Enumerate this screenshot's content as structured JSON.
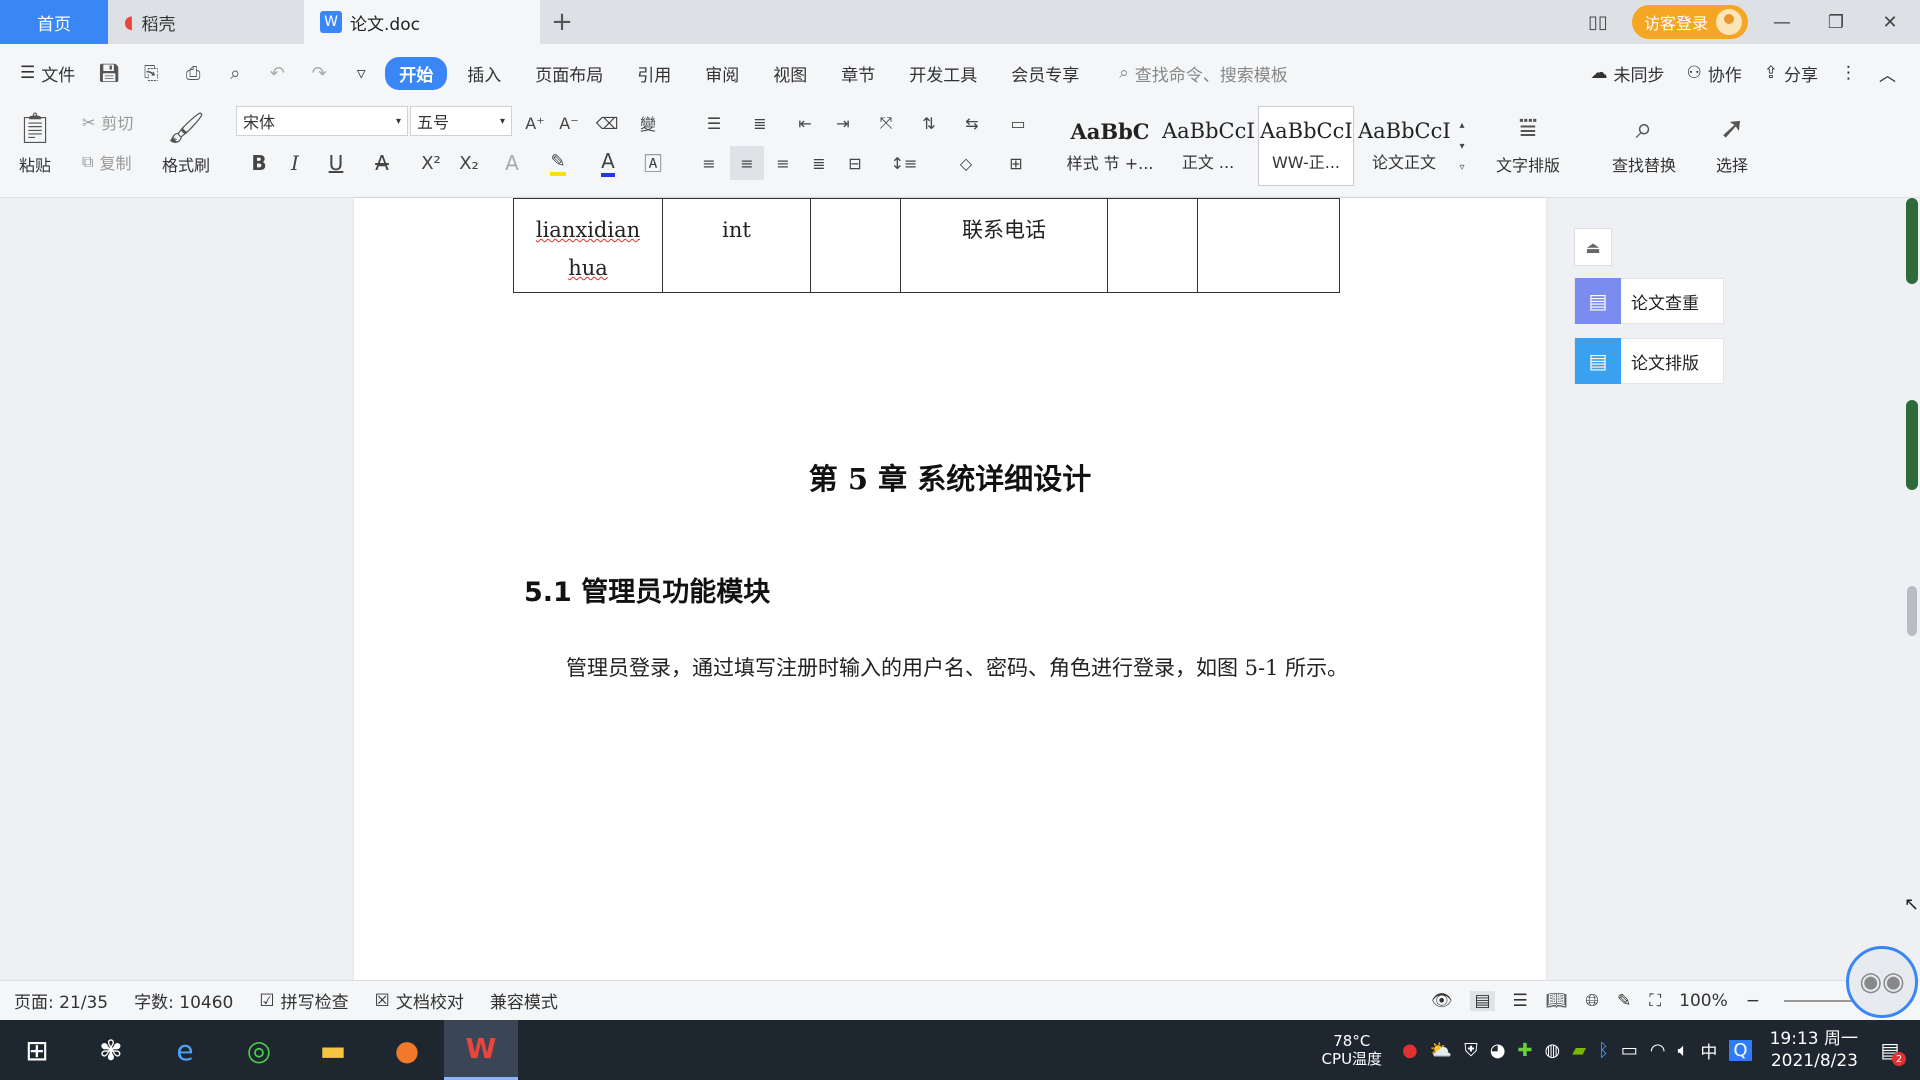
{
  "tabs": {
    "home": "首页",
    "daoke": "稻壳",
    "doc": "论文.doc",
    "add": "+"
  },
  "titlebar": {
    "login": "访客登录"
  },
  "menu": {
    "file": "文件",
    "items": [
      "开始",
      "插入",
      "页面布局",
      "引用",
      "审阅",
      "视图",
      "章节",
      "开发工具",
      "会员专享"
    ],
    "search_placeholder": "查找命令、搜索模板",
    "unsynced": "未同步",
    "collab": "协作",
    "share": "分享"
  },
  "ribbon": {
    "paste": "粘贴",
    "cut": "剪切",
    "copy": "复制",
    "format_painter": "格式刷",
    "font_name": "宋体",
    "font_size": "五号",
    "styles": [
      {
        "sample": "AaBbC",
        "name": "样式 节 +..."
      },
      {
        "sample": "AaBbCcDd",
        "name": "正文 ..."
      },
      {
        "sample": "AaBbCcI",
        "name": "WW-正..."
      },
      {
        "sample": "AaBbCcI",
        "name": "论文正文"
      }
    ],
    "text_layout": "文字排版",
    "find_replace": "查找替换",
    "select": "选择"
  },
  "document": {
    "table_row": [
      "lianxidian hua",
      "int",
      "",
      "联系电话",
      "",
      ""
    ],
    "chapter_title": "第 5 章  系统详细设计",
    "section_title": "5.1 管理员功能模块",
    "paragraph": "管理员登录，通过填写注册时输入的用户名、密码、角色进行登录，如图 5-1 所示。"
  },
  "side_panel": {
    "check": "论文查重",
    "layout": "论文排版"
  },
  "status": {
    "page": "页面: 21/35",
    "words": "字数: 10460",
    "spell": "拼写检查",
    "proof": "文档校对",
    "compat": "兼容模式",
    "zoom": "100%"
  },
  "taskbar": {
    "temp": "78°C",
    "cpu": "CPU温度",
    "ime": "中",
    "time": "19:13 周一",
    "date": "2021/8/23",
    "notif_count": "2"
  },
  "colors": {
    "accent": "#3a86f6",
    "login": "#f5a623",
    "spell_error": "#e03030"
  }
}
